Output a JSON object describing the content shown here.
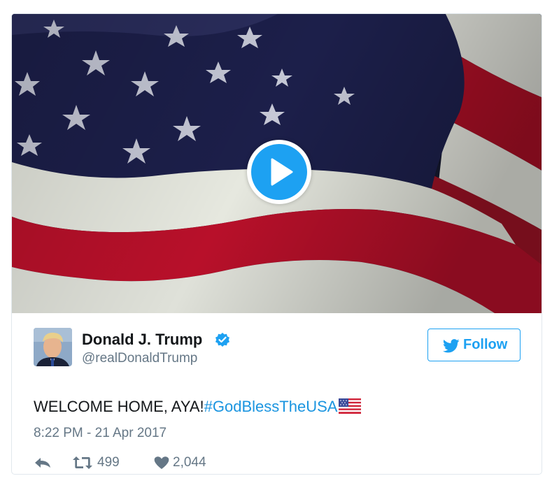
{
  "media": {
    "type": "video",
    "play_icon": "play-icon",
    "colors": {
      "blue": "#1c1f4a",
      "red": "#b8102a",
      "white": "#e6e8e1",
      "play": "#1da1f2"
    }
  },
  "author": {
    "name": "Donald J. Trump",
    "handle": "@realDonaldTrump",
    "verified": true,
    "verified_icon": "verified-badge-icon"
  },
  "follow_button": {
    "label": "Follow",
    "icon": "twitter-bird-icon",
    "color": "#1da1f2"
  },
  "tweet": {
    "text": "WELCOME HOME, AYA!",
    "hashtag": "#GodBlessTheUSA",
    "emoji": "us-flag-emoji",
    "timestamp": "8:22 PM - 21 Apr 2017"
  },
  "actions": {
    "reply_icon": "reply-icon",
    "retweet_icon": "retweet-icon",
    "retweets": "499",
    "like_icon": "heart-icon",
    "likes": "2,044"
  }
}
